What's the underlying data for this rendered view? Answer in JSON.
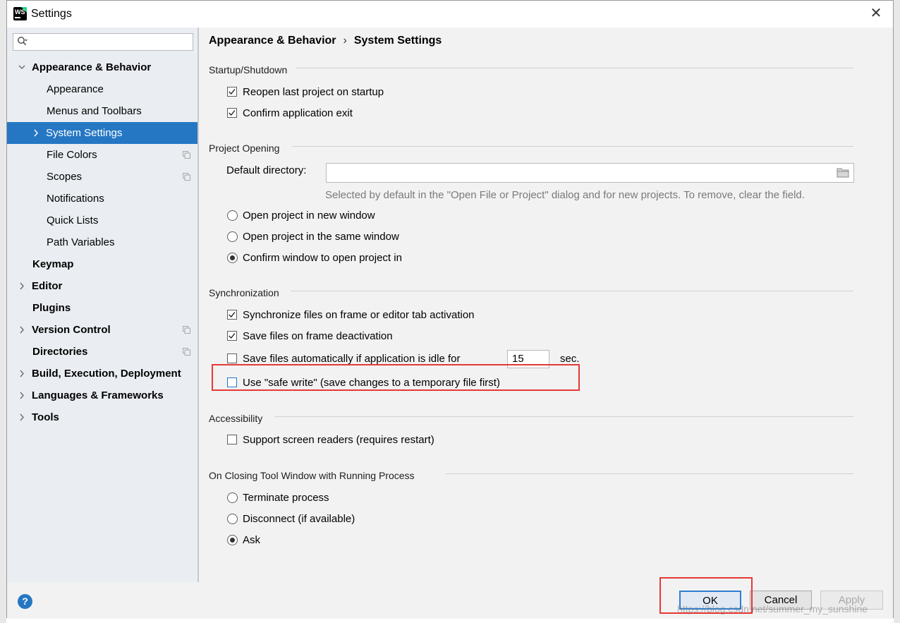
{
  "window": {
    "title": "Settings",
    "close": "✕"
  },
  "sidebar": {
    "search_placeholder": "",
    "items": [
      {
        "label": "Appearance & Behavior",
        "bold": true,
        "arrow": "down",
        "indent": 0
      },
      {
        "label": "Appearance",
        "bold": false,
        "arrow": "",
        "indent": 1
      },
      {
        "label": "Menus and Toolbars",
        "bold": false,
        "arrow": "",
        "indent": 1
      },
      {
        "label": "System Settings",
        "bold": false,
        "arrow": "right",
        "indent": 1,
        "selected": true
      },
      {
        "label": "File Colors",
        "bold": false,
        "arrow": "",
        "indent": 1,
        "config": true
      },
      {
        "label": "Scopes",
        "bold": false,
        "arrow": "",
        "indent": 1,
        "config": true
      },
      {
        "label": "Notifications",
        "bold": false,
        "arrow": "",
        "indent": 1
      },
      {
        "label": "Quick Lists",
        "bold": false,
        "arrow": "",
        "indent": 1
      },
      {
        "label": "Path Variables",
        "bold": false,
        "arrow": "",
        "indent": 1
      },
      {
        "label": "Keymap",
        "bold": true,
        "arrow": "",
        "indent": 0
      },
      {
        "label": "Editor",
        "bold": true,
        "arrow": "right",
        "indent": 0
      },
      {
        "label": "Plugins",
        "bold": true,
        "arrow": "",
        "indent": 0
      },
      {
        "label": "Version Control",
        "bold": true,
        "arrow": "right",
        "indent": 0,
        "config": true
      },
      {
        "label": "Directories",
        "bold": true,
        "arrow": "",
        "indent": 0,
        "config": true
      },
      {
        "label": "Build, Execution, Deployment",
        "bold": true,
        "arrow": "right",
        "indent": 0
      },
      {
        "label": "Languages & Frameworks",
        "bold": true,
        "arrow": "right",
        "indent": 0
      },
      {
        "label": "Tools",
        "bold": true,
        "arrow": "right",
        "indent": 0
      }
    ]
  },
  "breadcrumb": {
    "parent": "Appearance & Behavior",
    "separator": "›",
    "current": "System Settings"
  },
  "startup": {
    "title": "Startup/Shutdown",
    "reopen": {
      "label": "Reopen last project on startup",
      "checked": true
    },
    "confirm_exit": {
      "label": "Confirm application exit",
      "checked": true
    }
  },
  "project_opening": {
    "title": "Project Opening",
    "dir_label": "Default directory:",
    "dir_value": "",
    "hint": "Selected by default in the \"Open File or Project\" dialog and for new projects. To remove, clear the field.",
    "new_window": {
      "label": "Open project in new window",
      "selected": false
    },
    "same_window": {
      "label": "Open project in the same window",
      "selected": false
    },
    "confirm_window": {
      "label": "Confirm window to open project in",
      "selected": true
    }
  },
  "sync": {
    "title": "Synchronization",
    "sync_files": {
      "label": "Synchronize files on frame or editor tab activation",
      "checked": true
    },
    "save_deactivation": {
      "label": "Save files on frame deactivation",
      "checked": true
    },
    "save_idle": {
      "label": "Save files automatically if application is idle for",
      "checked": false
    },
    "idle_value": "15",
    "idle_unit": "sec.",
    "safe_write": {
      "label": "Use \"safe write\" (save changes to a temporary file first)",
      "checked": false
    }
  },
  "accessibility": {
    "title": "Accessibility",
    "screen_readers": {
      "label": "Support screen readers (requires restart)",
      "checked": false
    }
  },
  "closing": {
    "title": "On Closing Tool Window with Running Process",
    "terminate": {
      "label": "Terminate process",
      "selected": false
    },
    "disconnect": {
      "label": "Disconnect (if available)",
      "selected": false
    },
    "ask": {
      "label": "Ask",
      "selected": true
    }
  },
  "buttons": {
    "help": "?",
    "ok": "OK",
    "cancel": "Cancel",
    "apply": "Apply"
  },
  "watermark": "https://blog.csdn.net/summer_my_sunshine",
  "colors": {
    "accent": "#2577c3",
    "highlight": "#e53935",
    "sidebar_bg": "#eaeef2"
  }
}
